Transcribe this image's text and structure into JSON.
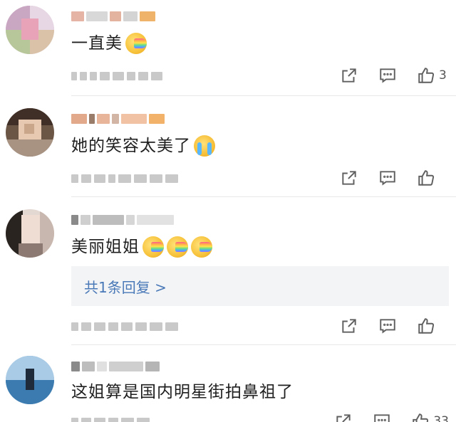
{
  "comments": [
    {
      "text": "一直美",
      "emojis": [
        "rainbow-kiss-emoji"
      ],
      "like_count": "3"
    },
    {
      "text": "她的笑容太美了",
      "emojis": [
        "crying-emoji"
      ],
      "like_count": ""
    },
    {
      "text": "美丽姐姐",
      "emojis": [
        "rainbow-kiss-emoji",
        "rainbow-kiss-emoji",
        "rainbow-kiss-emoji"
      ],
      "like_count": "",
      "reply_link": "共1条回复 >"
    },
    {
      "text": "这姐算是国内明星街拍鼻祖了",
      "emojis": [],
      "like_count": "33"
    }
  ],
  "colors": {
    "link": "#4a79b8",
    "icon": "#5f5f5f",
    "divider": "#e8e8e8",
    "reply_bg": "#f3f4f6"
  },
  "icons": [
    "share-icon",
    "comment-icon",
    "thumbs-up-icon"
  ]
}
